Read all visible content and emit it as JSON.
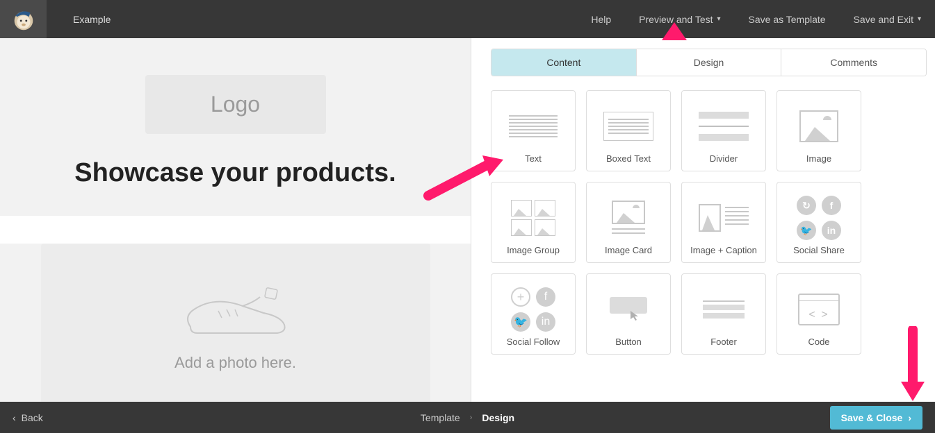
{
  "topbar": {
    "campaign_name": "Example",
    "links": {
      "help": "Help",
      "preview": "Preview and Test",
      "save_template": "Save as Template",
      "save_exit": "Save and Exit"
    }
  },
  "preview": {
    "logo_placeholder": "Logo",
    "headline": "Showcase your products.",
    "photo_placeholder": "Add a photo here."
  },
  "editor": {
    "tabs": {
      "content": "Content",
      "design": "Design",
      "comments": "Comments"
    },
    "active_tab": "content",
    "blocks": {
      "text": "Text",
      "boxed_text": "Boxed Text",
      "divider": "Divider",
      "image": "Image",
      "image_group": "Image Group",
      "image_card": "Image Card",
      "image_caption": "Image + Caption",
      "social_share": "Social Share",
      "social_follow": "Social Follow",
      "button": "Button",
      "footer": "Footer",
      "code": "Code"
    }
  },
  "bottombar": {
    "back": "Back",
    "crumb_template": "Template",
    "crumb_design": "Design",
    "save_close": "Save & Close"
  }
}
